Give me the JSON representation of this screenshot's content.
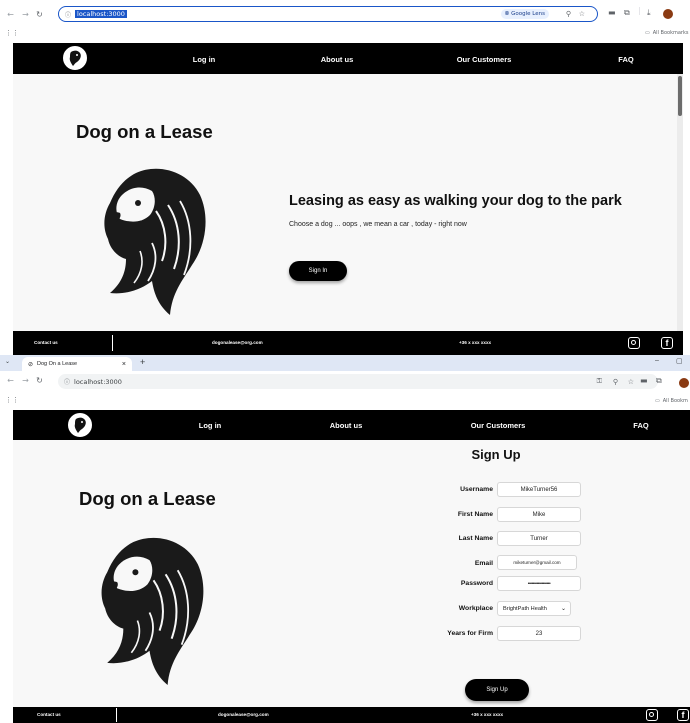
{
  "window1": {
    "url": "localhost:3000",
    "lens_label": "Google Lens",
    "bookmarks_label": "All Bookmarks"
  },
  "window2": {
    "tab_title": "Dog On a Lease",
    "new_tab_symbol": "+",
    "url": "localhost:3000",
    "bookmarks_label": "All Bookm"
  },
  "site": {
    "nav": [
      "Log in",
      "About us",
      "Our Customers",
      "FAQ"
    ],
    "brand": "Dog on a Lease",
    "headline": "Leasing as easy as walking your dog to the park",
    "subline": "Choose a dog ... oops , we mean a car , today - right now",
    "signin_label": "Sign In",
    "footer": {
      "contact": "Contact us",
      "email": "dogonalease@org.com",
      "phone": "+36 x xxx xxxx"
    }
  },
  "signup": {
    "title": "Sign Up",
    "fields": [
      {
        "label": "Username",
        "value": "MikeTurner56"
      },
      {
        "label": "First Name",
        "value": "Mike"
      },
      {
        "label": "Last Name",
        "value": "Turner"
      },
      {
        "label": "Email",
        "value": "miketurner@gmail.com"
      },
      {
        "label": "Password",
        "value": "••••••••••••••••••"
      },
      {
        "label": "Workplace",
        "value": "BrightPath Health"
      },
      {
        "label": "Years for Firm",
        "value": "23"
      }
    ],
    "submit_label": "Sign Up"
  },
  "colors": {
    "nav_bg": "#000000",
    "page_bg": "#f8f8f8",
    "omnibox_selected": "#e8f0fe",
    "url_highlight": "#1a56c8",
    "tabstrip_bg": "#dfe7f5"
  },
  "icons": [
    "back-arrow-icon",
    "forward-arrow-icon",
    "reload-icon",
    "info-icon",
    "google-lens-icon",
    "zoom-icon",
    "star-icon",
    "extensions-icon",
    "download-icon",
    "profile-avatar-icon",
    "apps-grid-icon",
    "folder-icon",
    "instagram-icon",
    "facebook-icon",
    "dog-logo-icon"
  ]
}
